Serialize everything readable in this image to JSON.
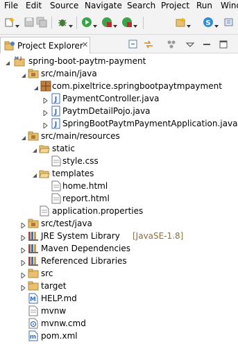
{
  "menu": [
    "File",
    "Edit",
    "Source",
    "Navigate",
    "Search",
    "Project",
    "Run",
    "Wind"
  ],
  "panel": {
    "tab_label": "Project Explorer",
    "close_glyph": "✕"
  },
  "tree": {
    "project": "spring-boot-paytm-payment",
    "src_main_java": "src/main/java",
    "package": "com.pixeltrice.springbootpaytmpayment",
    "file1": "PaymentController.java",
    "file2": "PaytmDetailPojo.java",
    "file3": "SpringBootPaytmPaymentApplication.java",
    "src_main_resources": "src/main/resources",
    "static": "static",
    "style": "style.css",
    "templates": "templates",
    "home": "home.html",
    "report": "report.html",
    "app_props": "application.properties",
    "src_test_java": "src/test/java",
    "jre": "JRE System Library",
    "jre_decor": "[JavaSE-1.8]",
    "maven": "Maven Dependencies",
    "ref_libs": "Referenced Libraries",
    "src": "src",
    "target": "target",
    "help": "HELP.md",
    "mvnw": "mvnw",
    "mvnw_cmd": "mvnw.cmd",
    "pom": "pom.xml"
  },
  "colors": {
    "folder": "#e8c070",
    "package": "#b5763a",
    "java": "#3b6fb8",
    "twisty": "#555555"
  }
}
